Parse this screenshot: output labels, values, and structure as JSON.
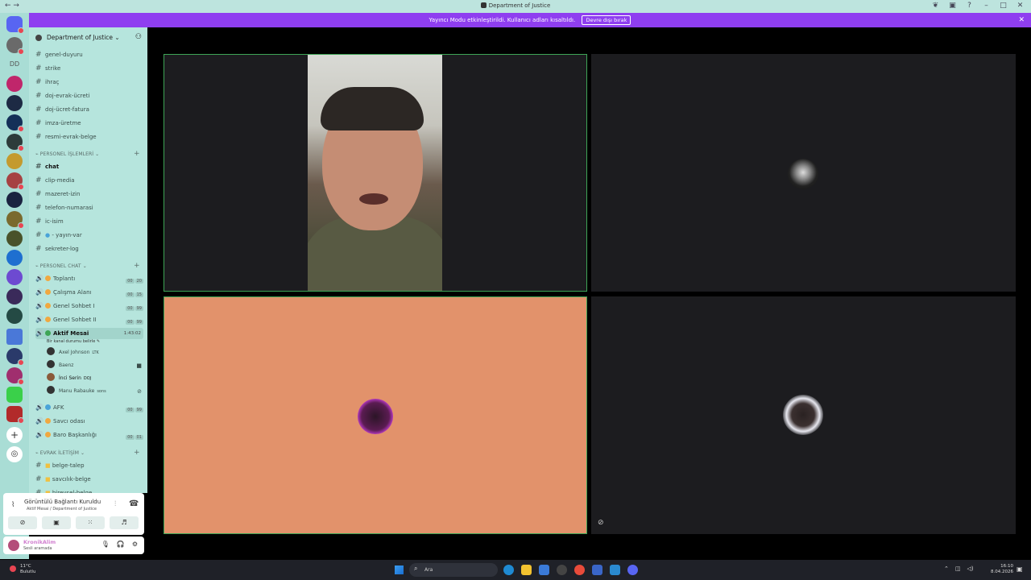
{
  "window": {
    "title": "Department of Justice"
  },
  "banner": {
    "text": "Yayıncı Modu etkinleştirildi. Kullanıcı adları kısaltıldı.",
    "button": "Devre dışı bırak"
  },
  "guilds": {
    "text_server": "DD"
  },
  "server": {
    "name": "Department of Justice"
  },
  "channels": {
    "top": [
      "genel-duyuru",
      "strike",
      "ihraç",
      "doj-evrak-ücreti",
      "doj-ücret-fatura",
      "imza-üretme",
      "resmi-evrak-belge"
    ],
    "cat1": "PERSONEL İŞLEMLERİ",
    "mid": [
      "chat",
      "clip-media",
      "mazeret-izin",
      "telefon-numarasi",
      "ic-isim",
      "- yayın-var",
      "sekreter-log"
    ],
    "cat2": "PERSONEL CHAT",
    "voice": [
      {
        "name": "Toplantı",
        "cap_a": "00",
        "cap_b": "20"
      },
      {
        "name": "Çalışma Alanı",
        "cap_a": "00",
        "cap_b": "15"
      },
      {
        "name": "Genel Sohbet I",
        "cap_a": "00",
        "cap_b": "99"
      },
      {
        "name": "Genel Sohbet II",
        "cap_a": "00",
        "cap_b": "99"
      }
    ],
    "active_voice": {
      "name": "Aktif Mesai",
      "timer": "1:43:02",
      "status": "Bir kanal durumu belirle"
    },
    "members": [
      {
        "name": "Axel Johnson",
        "tag": "LTK"
      },
      {
        "name": "Baenz",
        "tag": ""
      },
      {
        "name": "İnci Serin",
        "tag": "DOJ"
      },
      {
        "name": "Manu Rabauke",
        "tag": "sons"
      }
    ],
    "voice2": [
      {
        "name": "AFK",
        "cap_a": "00",
        "cap_b": "99"
      },
      {
        "name": "Savcı odası",
        "cap_a": "",
        "cap_b": ""
      },
      {
        "name": "Baro Başkanlığı",
        "cap_a": "00",
        "cap_b": "01"
      }
    ],
    "cat3": "EVRAK İLETİŞİM",
    "bottom": [
      "belge-talep",
      "savcılık-belge",
      "bireysel-belge"
    ]
  },
  "voice_panel": {
    "status": "Görüntülü Bağlantı Kuruldu",
    "sub": "Aktif Mesai / Department of Justice"
  },
  "user": {
    "name": "KronikAlim",
    "status": "Sesli aramada"
  },
  "taskbar": {
    "temp": "11°C",
    "weather": "Bulutlu",
    "search": "Ara",
    "time": "16:10",
    "date": "8.04.2026"
  },
  "colors": {
    "accent": "#8f3ef0",
    "speaking_border": "#3ea556",
    "tile_orange": "#e2926b"
  }
}
